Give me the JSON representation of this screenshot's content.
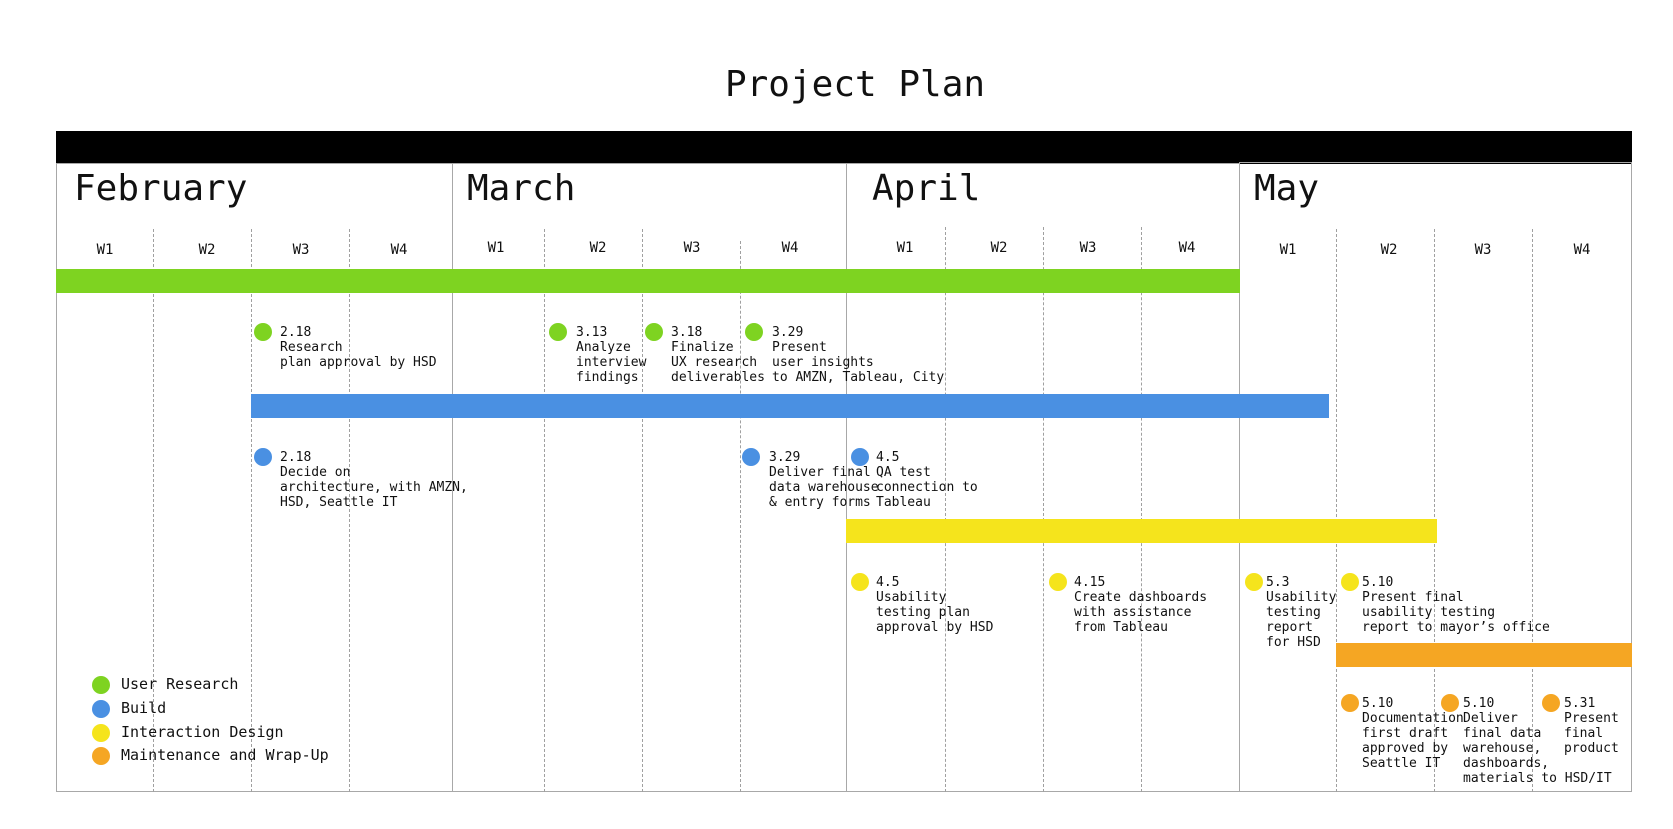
{
  "title": "Project Plan",
  "months": [
    "February",
    "March",
    "April",
    "May"
  ],
  "week_label": [
    "W1",
    "W2",
    "W3",
    "W4"
  ],
  "colors": {
    "user_research": "#7ed321",
    "build": "#4a90e2",
    "interaction_design": "#f5e41c",
    "maintenance": "#f5a623"
  },
  "legend": [
    {
      "label": "User Research",
      "color": "#7ed321"
    },
    {
      "label": "Build",
      "color": "#4a90e2"
    },
    {
      "label": "Interaction Design",
      "color": "#f5e41c"
    },
    {
      "label": "Maintenance and Wrap-Up",
      "color": "#f5a623"
    }
  ],
  "milestones": {
    "research_plan": {
      "date": "2.18",
      "text": "Research\nplan approval by HSD"
    },
    "interview_findings": {
      "date": "3.13",
      "text": "Analyze\ninterview\nfindings"
    },
    "ux_deliverables": {
      "date": "3.18",
      "text": "Finalize\nUX research\ndeliverables"
    },
    "user_insights": {
      "date": "3.29",
      "text": "Present\nuser insights\nto AMZN, Tableau, City"
    },
    "architecture": {
      "date": "2.18",
      "text": "Decide on\narchitecture, with AMZN,\nHSD, Seattle IT"
    },
    "data_warehouse": {
      "date": "3.29",
      "text": "Deliver final\ndata warehouse\n& entry forms"
    },
    "qa_test": {
      "date": "4.5",
      "text": "QA test\nconnection to\nTableau"
    },
    "usability_plan": {
      "date": "4.5",
      "text": "Usability\ntesting plan\napproval by HSD"
    },
    "dashboards": {
      "date": "4.15",
      "text": "Create dashboards\nwith assistance\nfrom Tableau"
    },
    "usability_report": {
      "date": "5.3",
      "text": "Usability\ntesting\nreport\nfor HSD"
    },
    "present_usability": {
      "date": "5.10",
      "text": "Present final\nusability testing\nreport to mayor’s office"
    },
    "documentation": {
      "date": "5.10",
      "text": "Documentation\nfirst draft\napproved by\nSeattle IT"
    },
    "deliver_final": {
      "date": "5.10",
      "text": "Deliver\nfinal data\nwarehouse,\ndashboards,\nmaterials to HSD/IT"
    },
    "present_product": {
      "date": "5.31",
      "text": "Present\nfinal\nproduct"
    }
  }
}
